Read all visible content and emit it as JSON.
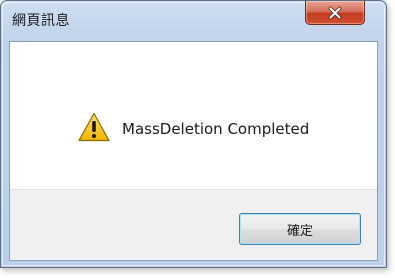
{
  "dialog": {
    "title": "網頁訊息",
    "message": "MassDeletion Completed",
    "ok_label": "確定",
    "icon": "warning-icon",
    "close_icon": "close-icon"
  },
  "colors": {
    "frame": "#bcd0e8",
    "close_button": "#c23b22",
    "warning_fill": "#f5c400",
    "button_border": "#3c7fb1"
  }
}
